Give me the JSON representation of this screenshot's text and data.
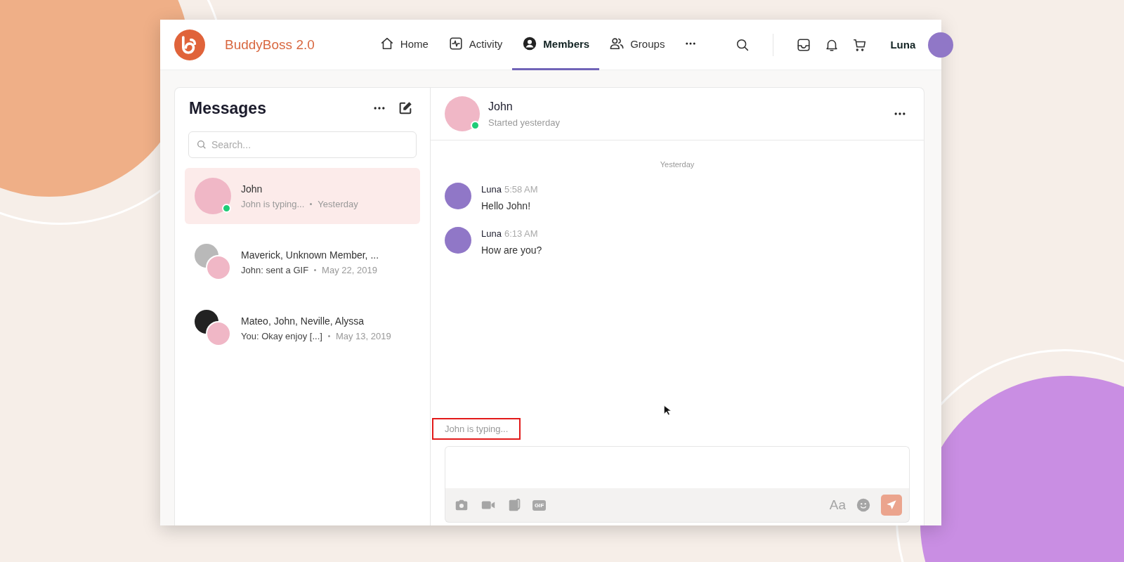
{
  "brand": {
    "name": "BuddyBoss 2.0"
  },
  "nav": [
    {
      "label": "Home",
      "kind": "home",
      "selected": false
    },
    {
      "label": "Activity",
      "kind": "activity",
      "selected": false
    },
    {
      "label": "Members",
      "kind": "member",
      "selected": true
    },
    {
      "label": "Groups",
      "kind": "groups",
      "selected": false
    }
  ],
  "user": {
    "name": "Luna"
  },
  "messages_panel": {
    "title": "Messages",
    "search": {
      "placeholder": "Search..."
    },
    "threads": [
      {
        "kind": "single",
        "name": "John",
        "preview": "John is typing...",
        "date": "Yesterday",
        "selected": true,
        "online": true,
        "typing": true
      },
      {
        "kind": "group",
        "name": "Maverick, Unknown Member, ...",
        "preview": "John: sent a GIF",
        "date": "May 22, 2019",
        "selected": false,
        "online": false,
        "typing": false
      },
      {
        "kind": "group",
        "name": "Mateo, John, Neville, Alyssa",
        "preview": "You: Okay enjoy [...]",
        "date": "May 13, 2019",
        "selected": false,
        "online": false,
        "typing": false
      }
    ]
  },
  "conversation": {
    "name": "John",
    "subtitle": "Started yesterday",
    "online": true,
    "day": "Yesterday",
    "messages": [
      {
        "author": "Luna",
        "time": "5:58 AM",
        "text": "Hello John!"
      },
      {
        "author": "Luna",
        "time": "6:13 AM",
        "text": "How are you?"
      }
    ],
    "typing": {
      "text": "John is typing...",
      "highlighted": true
    },
    "composer": {
      "tools": [
        {
          "kind": "camera"
        },
        {
          "kind": "video"
        },
        {
          "kind": "attachment"
        },
        {
          "kind": "gif",
          "label": "GIF"
        }
      ],
      "right_tools": [
        {
          "kind": "format",
          "label": "Aa"
        },
        {
          "kind": "emoji"
        }
      ]
    }
  }
}
